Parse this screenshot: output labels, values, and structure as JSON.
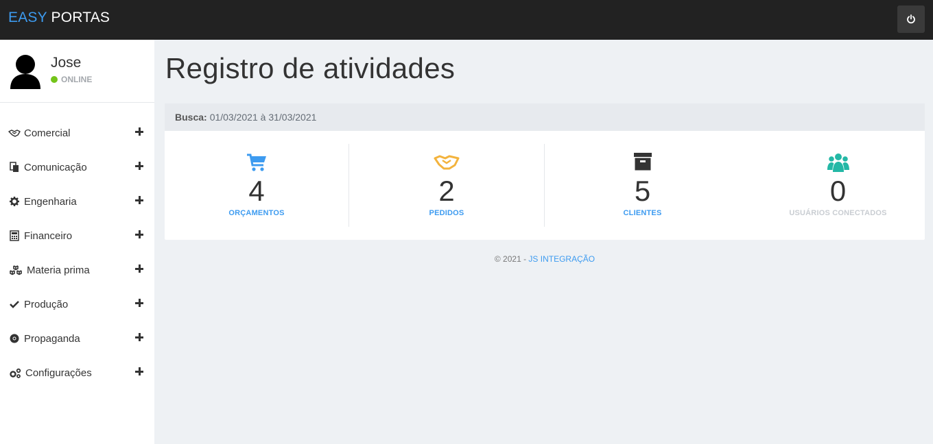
{
  "brand": {
    "part1": "EASY",
    "part2": "PORTAS"
  },
  "topbar": {
    "power_icon": "power-icon"
  },
  "user": {
    "name": "Jose",
    "status": "ONLINE",
    "status_color": "#74c41a"
  },
  "menu": [
    {
      "label": "Comercial",
      "icon": "handshake-icon"
    },
    {
      "label": "Comunicação",
      "icon": "documents-icon"
    },
    {
      "label": "Engenharia",
      "icon": "gear-icon"
    },
    {
      "label": "Financeiro",
      "icon": "calculator-icon"
    },
    {
      "label": "Materia prima",
      "icon": "cubes-icon"
    },
    {
      "label": "Produção",
      "icon": "check-icon"
    },
    {
      "label": "Propaganda",
      "icon": "chrome-icon"
    },
    {
      "label": "Configurações",
      "icon": "gears-icon"
    }
  ],
  "page": {
    "title": "Registro de atividades"
  },
  "search": {
    "label": "Busca:",
    "value": "01/03/2021 à 31/03/2021"
  },
  "stats": [
    {
      "value": "4",
      "label": "ORÇAMENTOS",
      "icon": "cart-icon",
      "color": "#3d9bf0"
    },
    {
      "value": "2",
      "label": "PEDIDOS",
      "icon": "handshake-icon",
      "color": "#f3b33d"
    },
    {
      "value": "5",
      "label": "CLIENTES",
      "icon": "archive-icon",
      "color": "#3d9bf0"
    },
    {
      "value": "0",
      "label": "USUÁRIOS CONECTADOS",
      "icon": "users-icon",
      "color": "#c9cdd2"
    }
  ],
  "footer": {
    "copyright": "© 2021 -",
    "link": "JS INTEGRAÇÃO"
  },
  "colors": {
    "accent": "#3d9bf0",
    "topbar": "#222222",
    "background": "#eef1f4"
  }
}
